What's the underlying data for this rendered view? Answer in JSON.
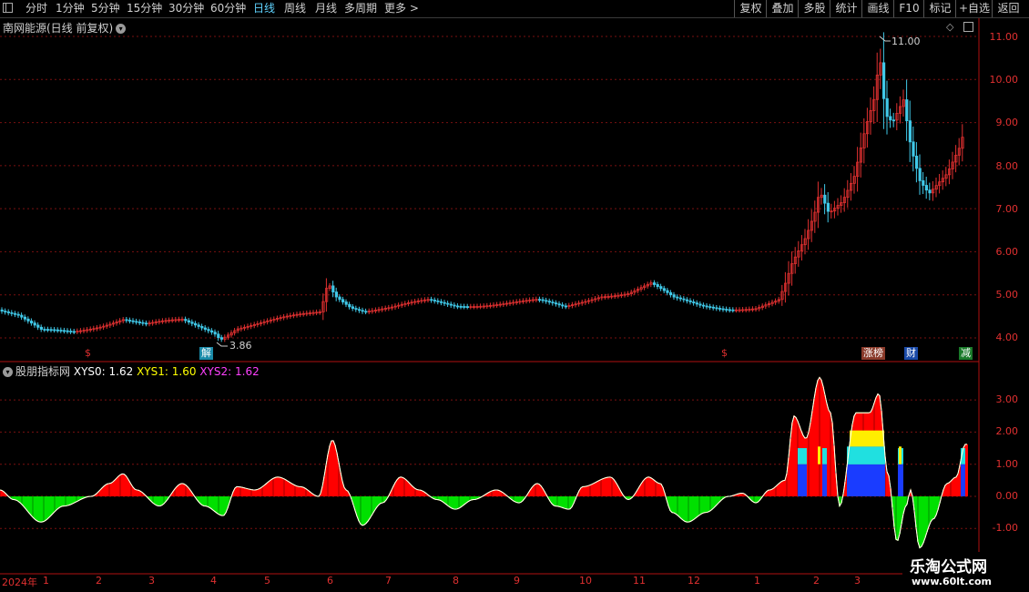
{
  "toolbar": {
    "periods": [
      "分时",
      "1分钟",
      "5分钟",
      "15分钟",
      "30分钟",
      "60分钟",
      "日线",
      "周线",
      "月线",
      "多周期",
      "更多 >"
    ],
    "active_period": "日线",
    "right_buttons": [
      "复权",
      "叠加",
      "多股",
      "统计",
      "画线",
      "F10",
      "标记",
      "+自选",
      "返回"
    ]
  },
  "main_panel": {
    "title": "南网能源(日线 前复权)",
    "y_ticks": [
      "11.00",
      "10.00",
      "9.00",
      "8.00",
      "7.00",
      "6.00",
      "5.00",
      "4.00"
    ],
    "high_label": "11.00",
    "low_label": "3.86",
    "markers": [
      {
        "text": "$",
        "color": "#e03030"
      },
      {
        "text": "解",
        "color": "#5fd3ff"
      },
      {
        "text": "$",
        "color": "#e03030"
      },
      {
        "text": "涨榜",
        "color": "#ff9966"
      },
      {
        "text": "财",
        "color": "#5fa8ff"
      },
      {
        "text": "减",
        "color": "#6fe06f"
      }
    ]
  },
  "indicator_panel": {
    "name": "股朋指标网",
    "xys0_label": "XYS0:",
    "xys0_value": "1.62",
    "xys1_label": "XYS1:",
    "xys1_value": "1.60",
    "xys2_label": "XYS2:",
    "xys2_value": "1.62",
    "y_ticks": [
      "3.00",
      "2.00",
      "1.00",
      "0.00",
      "-1.00"
    ]
  },
  "time_axis": [
    "2024年",
    "1",
    "2",
    "3",
    "4",
    "5",
    "6",
    "7",
    "8",
    "9",
    "10",
    "11",
    "12",
    "1",
    "2",
    "3"
  ],
  "watermark": {
    "title": "乐淘公式网",
    "url": "www.60lt.com"
  },
  "colors": {
    "up": "#e03030",
    "down": "#40c8e8",
    "grid": "#7a1010",
    "positive": "#ff0000",
    "negative": "#00e000",
    "curve": "#ffffff",
    "xys1": "#ffff00",
    "xys2": "#ff40ff"
  },
  "chart_data": {
    "type": "candlestick+area",
    "price_series": [
      {
        "date": "2024-01",
        "price": 4.6
      },
      {
        "date": "2024-02",
        "price": 4.1
      },
      {
        "date": "2024-03",
        "price": 4.4
      },
      {
        "date": "2024-04",
        "price": 4.2
      },
      {
        "date": "2024-05",
        "price": 4.5
      },
      {
        "date": "2024-06",
        "price": 5.2
      },
      {
        "date": "2024-07",
        "price": 4.7
      },
      {
        "date": "2024-08",
        "price": 4.8
      },
      {
        "date": "2024-09",
        "price": 4.75
      },
      {
        "date": "2024-10",
        "price": 4.95
      },
      {
        "date": "2024-11",
        "price": 5.2
      },
      {
        "date": "2024-12",
        "price": 4.7
      },
      {
        "date": "2025-01",
        "price": 4.75
      },
      {
        "date": "2025-02",
        "price": 6.8
      },
      {
        "date": "2025-03",
        "price": 9.0
      }
    ],
    "price_ylim": [
      3.6,
      11.3
    ],
    "indicator_ylim": [
      -1.6,
      4.1
    ]
  }
}
